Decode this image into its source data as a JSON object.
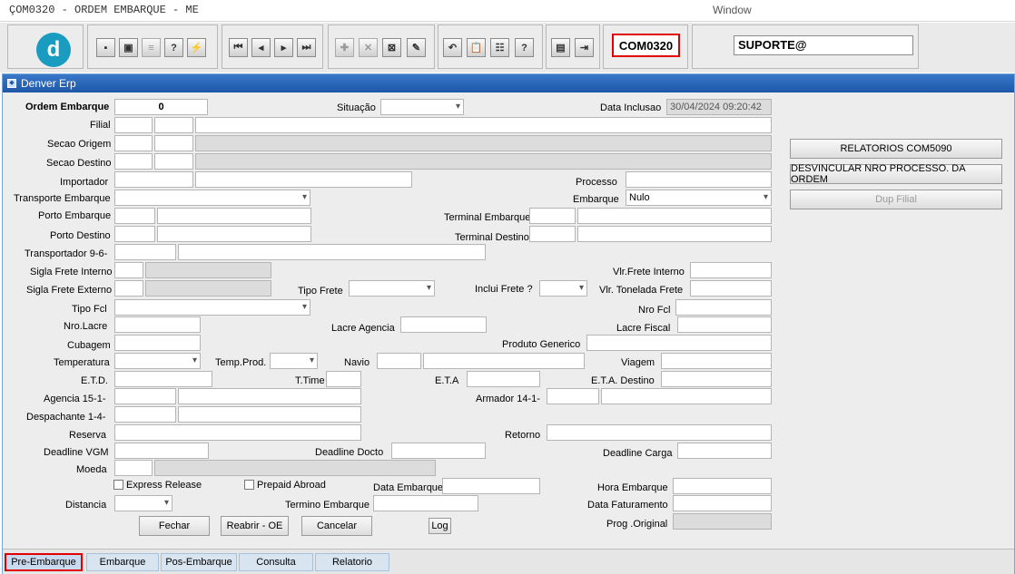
{
  "window": {
    "title": "ÇOM0320 - ORDEM EMBARQUE - ME",
    "menu": "Window",
    "subtitle": "Denver Erp"
  },
  "toolbar": {
    "logo_letter": "d",
    "form_code": "COM0320",
    "user": "SUPORTE@",
    "icons": [
      "save-icon",
      "window-icon",
      "print-icon",
      "query-icon",
      "execute-query-icon",
      "first-record-icon",
      "prev-record-icon",
      "next-record-icon",
      "last-record-icon",
      "insert-record-icon",
      "delete-record-icon",
      "clear-record-icon",
      "edit-icon",
      "undo-icon",
      "clipboard-icon",
      "list-icon",
      "help-icon",
      "menu-icon",
      "exit-icon"
    ]
  },
  "form": {
    "ordem_embarque": {
      "label": "Ordem Embarque",
      "value": "0"
    },
    "situacao": {
      "label": "Situação",
      "value": ""
    },
    "data_inclusao": {
      "label": "Data Inclusao",
      "value": "30/04/2024 09:20:42"
    },
    "filial": {
      "label": "Filial"
    },
    "secao_origem": {
      "label": "Secao Origem"
    },
    "secao_destino": {
      "label": "Secao Destino"
    },
    "importador": {
      "label": "Importador"
    },
    "processo": {
      "label": "Processo"
    },
    "transporte_embarque": {
      "label": "Transporte Embarque"
    },
    "embarque": {
      "label": "Embarque",
      "value": "Nulo"
    },
    "porto_embarque": {
      "label": "Porto Embarque"
    },
    "terminal_embarque": {
      "label": "Terminal Embarque"
    },
    "porto_destino": {
      "label": "Porto Destino"
    },
    "terminal_destino": {
      "label": "Terminal Destino"
    },
    "transportador": {
      "label": "Transportador 9-6-"
    },
    "sigla_frete_interno": {
      "label": "Sigla Frete Interno"
    },
    "vlr_frete_interno": {
      "label": "Vlr.Frete Interno"
    },
    "sigla_frete_externo": {
      "label": "Sigla Frete Externo"
    },
    "tipo_frete": {
      "label": "Tipo Frete"
    },
    "inclui_frete": {
      "label": "Inclui Frete ?"
    },
    "vlr_tonelada_frete": {
      "label": "Vlr. Tonelada Frete"
    },
    "tipo_fcl": {
      "label": "Tipo Fcl"
    },
    "nro_fcl": {
      "label": "Nro Fcl"
    },
    "nro_lacre": {
      "label": "Nro.Lacre"
    },
    "lacre_agencia": {
      "label": "Lacre Agencia"
    },
    "lacre_fiscal": {
      "label": "Lacre Fiscal"
    },
    "cubagem": {
      "label": "Cubagem"
    },
    "produto_generico": {
      "label": "Produto Generico"
    },
    "temperatura": {
      "label": "Temperatura"
    },
    "temp_prod": {
      "label": "Temp.Prod."
    },
    "navio": {
      "label": "Navio"
    },
    "viagem": {
      "label": "Viagem"
    },
    "etd": {
      "label": "E.T.D."
    },
    "t_time": {
      "label": "T.Time"
    },
    "eta": {
      "label": "E.T.A"
    },
    "eta_destino": {
      "label": "E.T.A. Destino"
    },
    "agencia": {
      "label": "Agencia 15-1-"
    },
    "armador": {
      "label": "Armador 14-1-"
    },
    "despachante": {
      "label": "Despachante 1-4-"
    },
    "reserva": {
      "label": "Reserva"
    },
    "retorno": {
      "label": "Retorno"
    },
    "deadline_vgm": {
      "label": "Deadline VGM"
    },
    "deadline_docto": {
      "label": "Deadline  Docto"
    },
    "deadline_carga": {
      "label": "Deadline Carga"
    },
    "moeda": {
      "label": "Moeda"
    },
    "express_release": {
      "label": "Express Release"
    },
    "prepaid_abroad": {
      "label": "Prepaid Abroad"
    },
    "data_embarque": {
      "label": "Data Embarque"
    },
    "hora_embarque": {
      "label": "Hora Embarque"
    },
    "distancia": {
      "label": "Distancia"
    },
    "termino_embarque": {
      "label": "Termino Embarque"
    },
    "data_faturamento": {
      "label": "Data Faturamento"
    },
    "prog_original": {
      "label": "Prog .Original"
    }
  },
  "side_buttons": {
    "relatorios": "RELATORIOS COM5090",
    "desvincular": "DESVINCULAR NRO PROCESSO. DA ORDEM",
    "dup_filial": "Dup Filial"
  },
  "buttons": {
    "fechar": "Fechar",
    "reabrir": "Reabrir - OE",
    "cancelar": "Cancelar",
    "log": "Log"
  },
  "tabs": [
    "Pre-Embarque",
    "Embarque",
    "Pos-Embarque",
    "Consulta",
    "Relatorio"
  ]
}
